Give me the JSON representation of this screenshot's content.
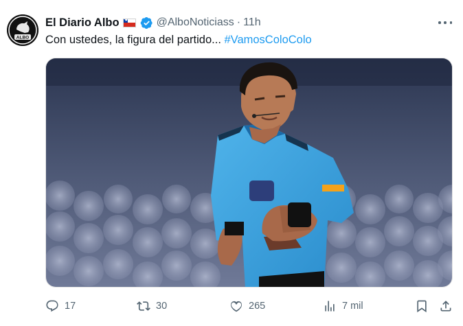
{
  "tweet": {
    "display_name": "El Diario Albo",
    "handle": "@AlboNoticiass",
    "separator": "·",
    "time": "11h",
    "text_prefix": "Con ustedes, la figura del partido... ",
    "hashtag": "#VamosColoColo",
    "avatar_text": "ALBO"
  },
  "actions": {
    "replies": "17",
    "retweets": "30",
    "likes": "265",
    "views": "7 mil"
  },
  "icons": {
    "reply": "comment-icon",
    "retweet": "retweet-icon",
    "like": "heart-icon",
    "views": "analytics-icon",
    "bookmark": "bookmark-icon",
    "share": "share-icon",
    "verified": "verified-badge-icon",
    "flag": "chile-flag-icon",
    "more": "more-icon"
  },
  "colors": {
    "accent": "#1d9bf0",
    "muted": "#536471",
    "text": "#0f1419"
  }
}
